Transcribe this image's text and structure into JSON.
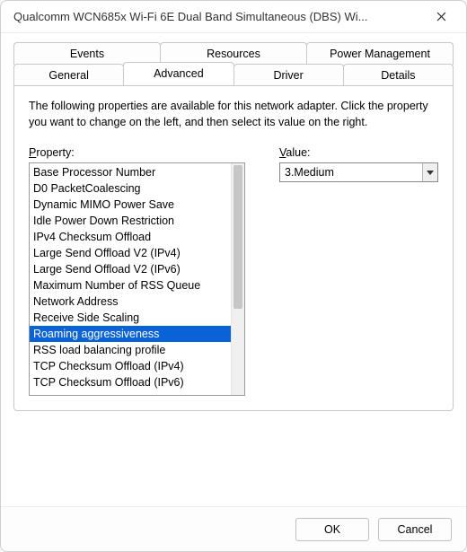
{
  "window": {
    "title": "Qualcomm WCN685x Wi-Fi 6E Dual Band Simultaneous (DBS) Wi..."
  },
  "tabs": {
    "row1": [
      "Events",
      "Resources",
      "Power Management"
    ],
    "row2": [
      "General",
      "Advanced",
      "Driver",
      "Details"
    ],
    "active": "Advanced"
  },
  "panel": {
    "description": "The following properties are available for this network adapter. Click the property you want to change on the left, and then select its value on the right.",
    "propertyLabel": "Property:",
    "valueLabel": "Value:",
    "properties": [
      "Base Processor Number",
      "D0 PacketCoalescing",
      "Dynamic MIMO Power Save",
      "Idle Power Down Restriction",
      "IPv4 Checksum Offload",
      "Large Send Offload V2 (IPv4)",
      "Large Send Offload V2 (IPv6)",
      "Maximum Number of RSS Queue",
      "Network Address",
      "Receive Side Scaling",
      "Roaming aggressiveness",
      "RSS load balancing profile",
      "TCP Checksum Offload (IPv4)",
      "TCP Checksum Offload (IPv6)"
    ],
    "selectedProperty": "Roaming aggressiveness",
    "selectedValue": "3.Medium"
  },
  "footer": {
    "ok": "OK",
    "cancel": "Cancel"
  }
}
